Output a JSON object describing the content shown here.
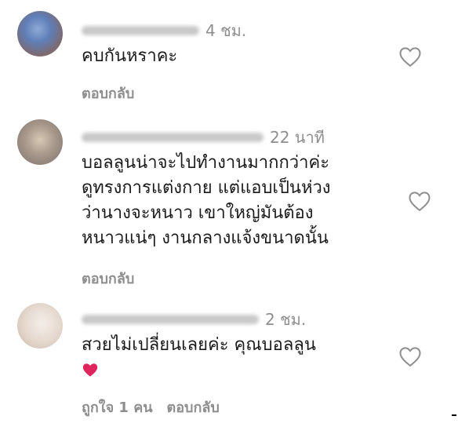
{
  "comments": [
    {
      "time": "4 ชม.",
      "lines": [
        "คบกันหราคะ"
      ],
      "reply_label": "ตอบกลับ",
      "like_icon": "heart-outline-icon"
    },
    {
      "time": "22 นาที",
      "lines": [
        "บอลลูนน่าจะไปทำงานมากกว่าค่ะ",
        "ดูทรงการแต่งกาย แต่แอบเป็นห่วง",
        "ว่านางจะหนาว เขาใหญ่มันต้อง",
        "หนาวแน่ๆ งานกลางแจ้งขนาดนั้น"
      ],
      "reply_label": "ตอบกลับ",
      "like_icon": "heart-outline-icon"
    },
    {
      "time": "2 ชม.",
      "lines": [
        "สวยไม่เปลี่ยนเลยค่ะ คุณบอลลูน"
      ],
      "emoji": "red-heart-emoji",
      "likes_label": "ถูกใจ 1 คน",
      "reply_label": "ตอบกลับ",
      "like_icon": "heart-outline-icon"
    }
  ],
  "colors": {
    "secondary_text": "#8e8e8e",
    "primary_text": "#1a1a1a",
    "emoji_heart": "#e0245e"
  }
}
